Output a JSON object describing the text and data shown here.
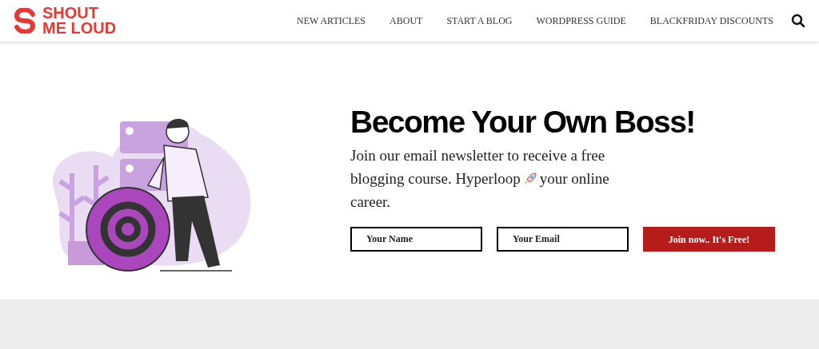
{
  "header": {
    "logo": [
      "SHOUT",
      "ME LOUD"
    ],
    "nav": [
      {
        "label": "NEW ARTICLES"
      },
      {
        "label": "ABOUT"
      },
      {
        "label": "START A BLOG"
      },
      {
        "label": "WORDPRESS GUIDE"
      },
      {
        "label": "BLACKFRIDAY DISCOUNTS"
      }
    ]
  },
  "hero": {
    "title": "Become Your Own Boss!",
    "text_lines": [
      "Join our email newsletter to receive a free",
      "blogging course. Hyperloop",
      "your online",
      "career."
    ],
    "fields": [
      {
        "placeholder": "Your Name"
      },
      {
        "placeholder": "Your Email"
      }
    ],
    "button": "Join now.. It's Free!"
  }
}
